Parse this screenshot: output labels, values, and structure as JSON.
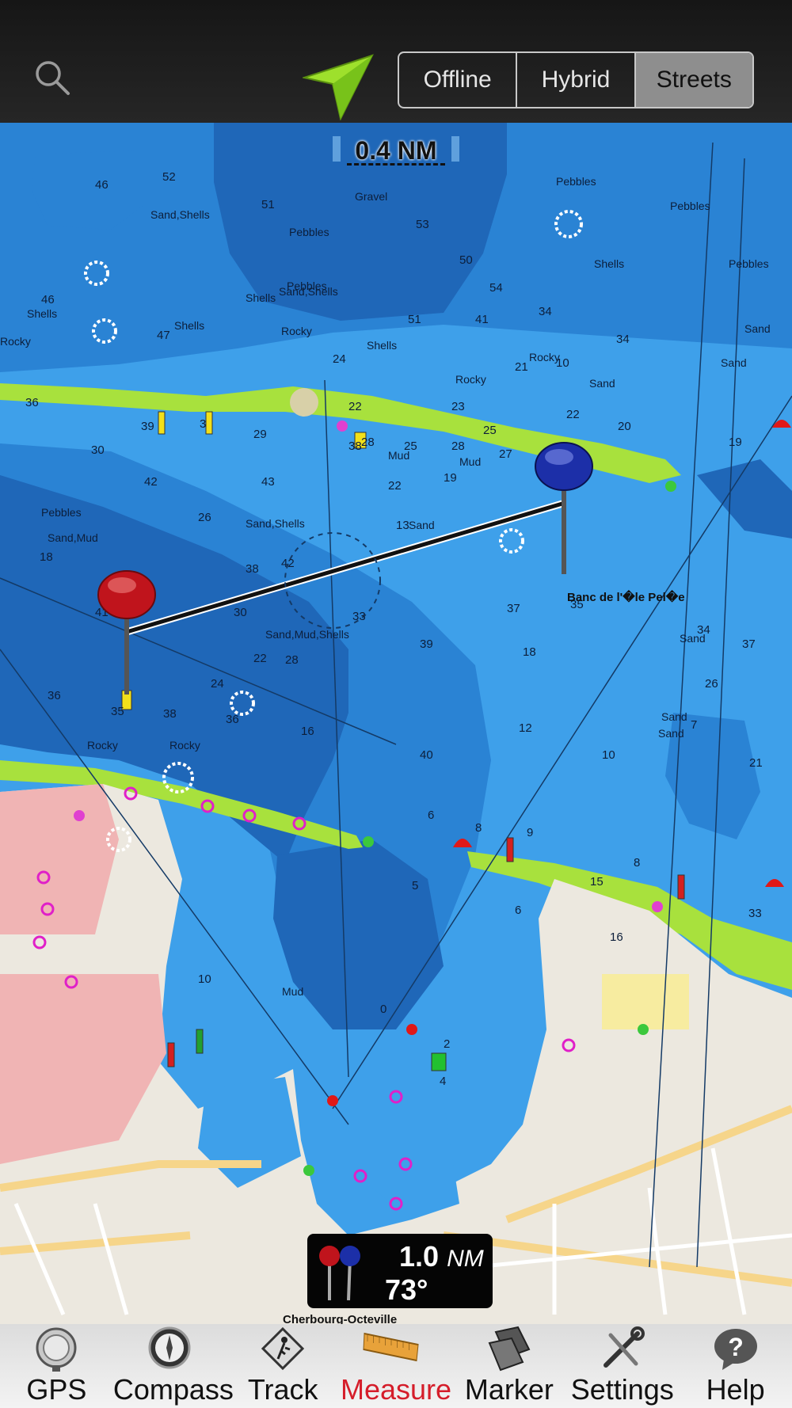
{
  "header": {
    "map_modes": [
      "Offline",
      "Hybrid",
      "Streets"
    ],
    "selected_mode": "Streets"
  },
  "map": {
    "scale_label": "0.4 NM",
    "place_names": {
      "bank": "Banc de l'�le Pel�e",
      "town": "Cherbourg-Octeville"
    },
    "seabed_labels": [
      "Gravel",
      "Sand,Shells",
      "Pebbles",
      "Shells",
      "Rocky",
      "Sand",
      "Mud",
      "Sand,Mud",
      "Sand,Mud,Shells"
    ],
    "soundings": [
      "46",
      "52",
      "51",
      "53",
      "47",
      "50",
      "54",
      "46",
      "51",
      "41",
      "34",
      "10",
      "34",
      "39",
      "3",
      "29",
      "30",
      "36",
      "28",
      "25",
      "22",
      "25",
      "24",
      "28",
      "23",
      "21",
      "22",
      "38",
      "27",
      "20",
      "19",
      "18",
      "42",
      "41",
      "42",
      "43",
      "26",
      "22",
      "19",
      "13",
      "38",
      "30",
      "22",
      "24",
      "28",
      "33",
      "39",
      "37",
      "35",
      "18",
      "34",
      "26",
      "37",
      "36",
      "35",
      "38",
      "36",
      "16",
      "40",
      "12",
      "10",
      "7",
      "21",
      "6",
      "5",
      "8",
      "9",
      "8",
      "6",
      "15",
      "16",
      "33",
      "10",
      "0",
      "2",
      "4"
    ],
    "colors": {
      "deep": "#1f67b8",
      "mid": "#2a83d4",
      "shallow": "#3ea0ea",
      "intertidal": "#a8e13d",
      "land": "#ece8df",
      "restricted": "#f0b4b4",
      "measure_line": "#111111"
    }
  },
  "measure": {
    "distance_value": "1.0",
    "distance_unit": "NM",
    "bearing": "73°",
    "start_pin_color": "#c0141c",
    "end_pin_color": "#1c2fa8"
  },
  "toolbar": {
    "items": [
      {
        "label": "GPS",
        "icon": "gps-icon"
      },
      {
        "label": "Compass",
        "icon": "compass-icon"
      },
      {
        "label": "Track",
        "icon": "track-icon"
      },
      {
        "label": "Measure",
        "icon": "ruler-icon"
      },
      {
        "label": "Marker",
        "icon": "marker-icon"
      },
      {
        "label": "Settings",
        "icon": "settings-icon"
      },
      {
        "label": "Help",
        "icon": "help-icon"
      }
    ],
    "active": "Measure",
    "active_color": "#d51d2a"
  }
}
